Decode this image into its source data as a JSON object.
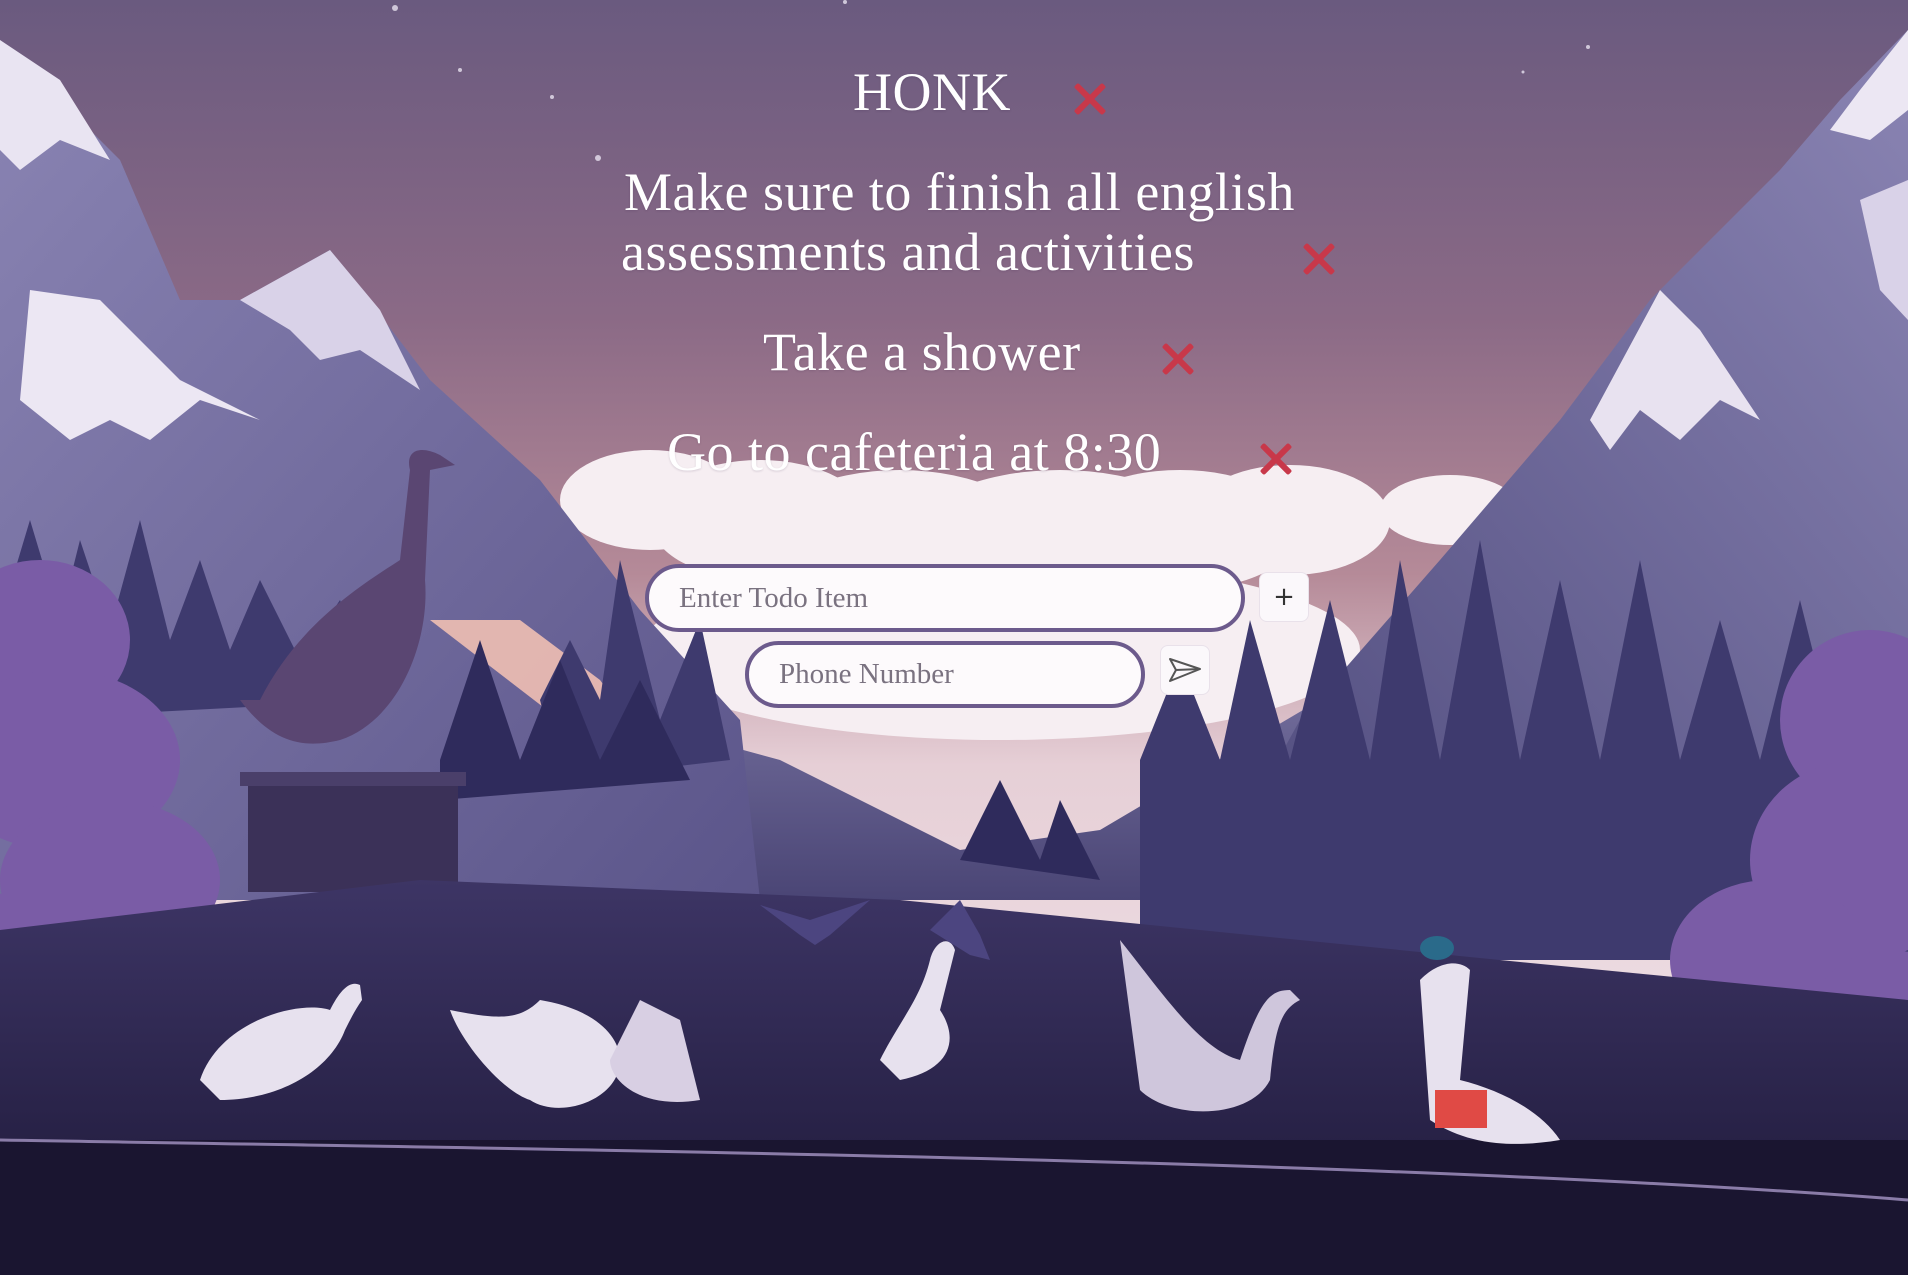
{
  "todos": [
    {
      "lines": [
        "HONK"
      ]
    },
    {
      "lines": [
        "Make sure to finish all english",
        "assessments and activities"
      ]
    },
    {
      "lines": [
        "Take a shower"
      ]
    },
    {
      "lines": [
        "Go to cafeteria at 8:30"
      ]
    }
  ],
  "form": {
    "todo_placeholder": "Enter Todo Item",
    "todo_value": "",
    "add_label": "+",
    "phone_placeholder": "Phone Number",
    "phone_value": "",
    "send_icon": "send-icon"
  },
  "icons": {
    "delete": "close-icon",
    "add": "plus-icon"
  },
  "colors": {
    "delete_x": "#c8384a",
    "input_border": "#6c5a8c",
    "text": "#ffffff"
  }
}
